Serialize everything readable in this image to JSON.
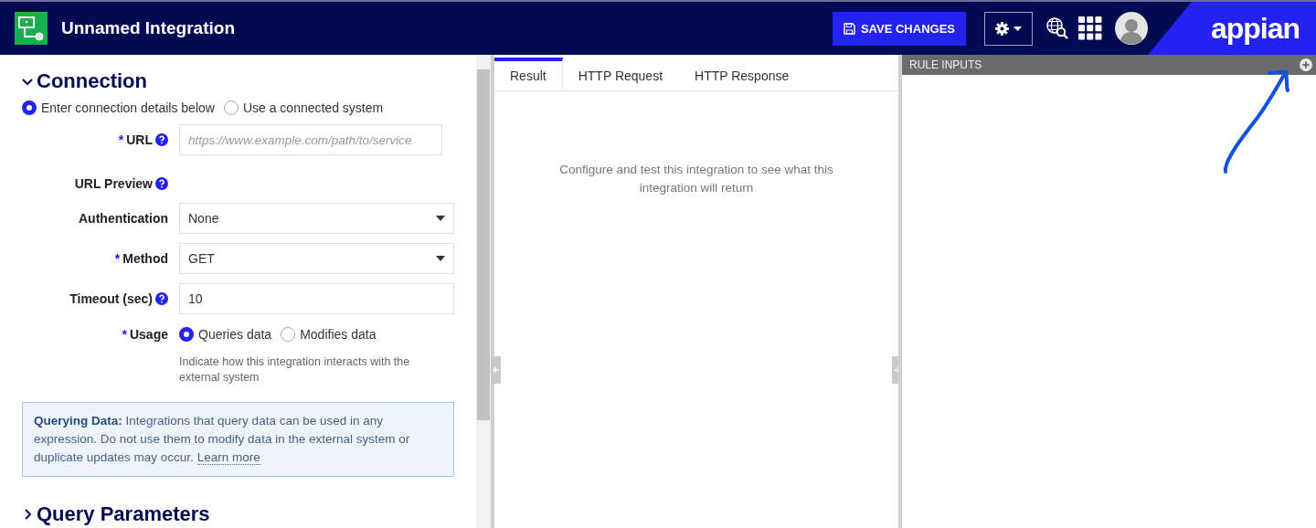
{
  "header": {
    "title": "Unnamed Integration",
    "save_button": "SAVE CHANGES",
    "logo": "appian"
  },
  "connection": {
    "title": "Connection",
    "expanded": true,
    "source_options": [
      {
        "label": "Enter connection details below",
        "selected": true
      },
      {
        "label": "Use a connected system",
        "selected": false
      }
    ],
    "fields": [
      {
        "kind": "text",
        "label": "URL",
        "required_mark": "*",
        "help": true,
        "placeholder": "https://www.example.com/path/to/service"
      },
      {
        "kind": "static",
        "label": "URL Preview",
        "help": true
      },
      {
        "kind": "select",
        "label": "Authentication",
        "value": "None"
      },
      {
        "kind": "select",
        "label": "Method",
        "required_mark": "*",
        "value": "GET"
      },
      {
        "kind": "text",
        "label": "Timeout (sec)",
        "help": true,
        "value": "10"
      },
      {
        "kind": "radio",
        "label": "Usage",
        "required_mark": "*",
        "options": [
          {
            "label": "Queries data",
            "selected": true
          },
          {
            "label": "Modifies data",
            "selected": false
          }
        ],
        "instructions": "Indicate how this integration interacts with the external system"
      }
    ],
    "info": {
      "text": "**Querying Data:** Integrations that query data can be used in any expression. Do not use them to modify data in the external system or duplicate updates may occur.",
      "link": "Learn more"
    }
  },
  "query_parameters": {
    "title": "Query Parameters",
    "expanded": false
  },
  "result_tabs": [
    {
      "label": "Result",
      "selected": true
    },
    {
      "label": "HTTP Request",
      "selected": false
    },
    {
      "label": "HTTP Response",
      "selected": false
    }
  ],
  "result_message": "Configure and test this integration to see what this integration will return",
  "rule_inputs": {
    "title": "RULE INPUTS"
  }
}
